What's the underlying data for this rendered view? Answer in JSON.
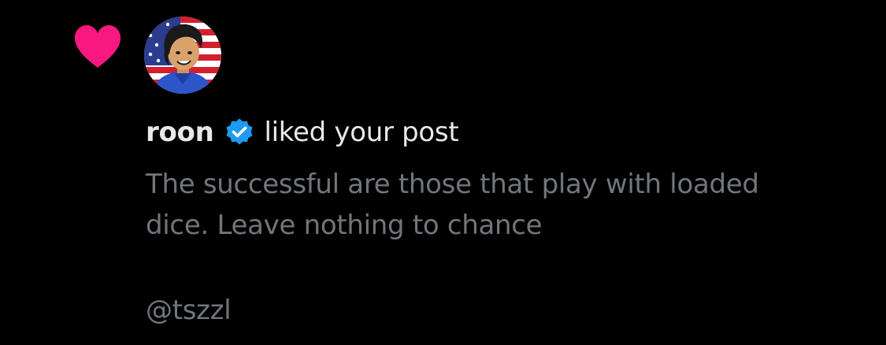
{
  "notification": {
    "type_icon": "heart-icon",
    "avatar_icon": "user-avatar-flag",
    "username": "roon",
    "verified_icon": "verified-badge-icon",
    "action_text": "liked your post",
    "post_text_line1": "The successful are those that play with loaded",
    "post_text_line2": "dice. Leave nothing to chance",
    "mention": "@tszzl"
  },
  "colors": {
    "background": "#000000",
    "heart": "#f91880",
    "primary_text": "#e7e9ea",
    "secondary_text": "#71767b",
    "verified": "#1d9bf0"
  }
}
